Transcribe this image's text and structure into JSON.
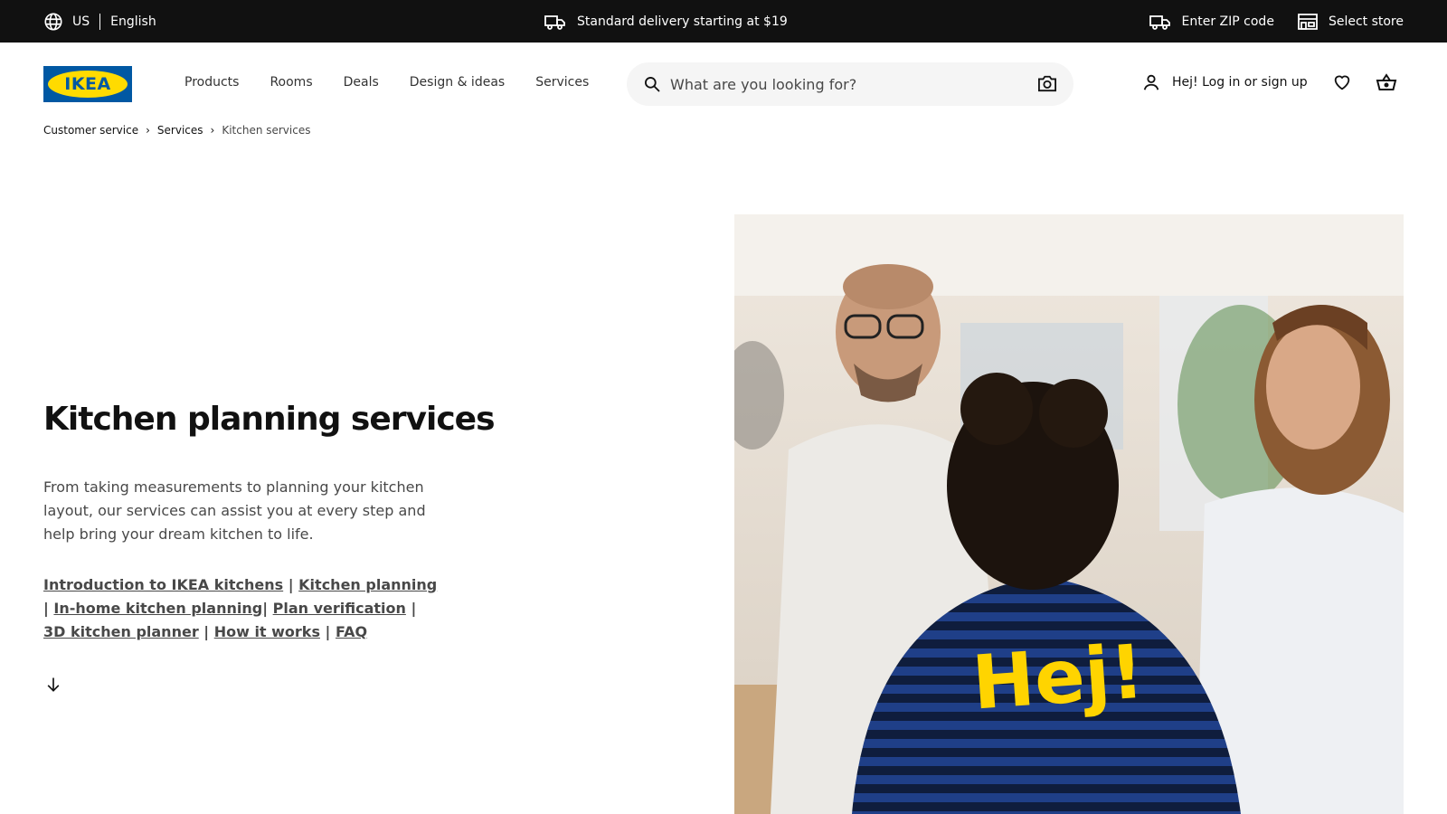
{
  "topbar": {
    "country": "US",
    "language": "English",
    "delivery_text": "Standard delivery starting at $19",
    "zip_label": "Enter ZIP code",
    "store_label": "Select store",
    "icons": [
      "globe-icon",
      "truck-icon",
      "truck-icon",
      "store-icon"
    ]
  },
  "header": {
    "logo_text": "IKEA",
    "nav": [
      "Products",
      "Rooms",
      "Deals",
      "Design & ideas",
      "Services"
    ],
    "search_placeholder": "What are you looking for?",
    "account_label": "Hej! Log in or sign up",
    "icons": [
      "search-icon",
      "camera-icon",
      "user-icon",
      "heart-icon",
      "cart-icon"
    ]
  },
  "breadcrumb": {
    "items": [
      "Customer service",
      "Services"
    ],
    "current": "Kitchen services"
  },
  "hero": {
    "title": "Kitchen planning services",
    "description": "From taking measurements to planning your kitchen layout, our services can assist you at every step and help bring your dream kitchen to life.",
    "links": [
      "Introduction to IKEA kitchens",
      "Kitchen planning",
      "In-home kitchen planning",
      "Plan verification",
      "3D kitchen planner",
      "How it works",
      "FAQ"
    ],
    "photo_shirt_text": "Hej!"
  },
  "colors": {
    "topbar_bg": "#111111",
    "ikea_blue": "#0058a3",
    "ikea_yellow": "#ffdb00",
    "search_bg": "#f5f5f5",
    "text_secondary": "#484848"
  }
}
